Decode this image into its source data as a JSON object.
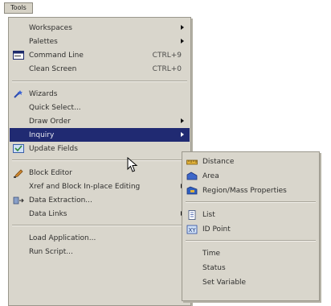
{
  "menubar": {
    "title": "Tools"
  },
  "tools_menu": {
    "items": [
      {
        "label": "Workspaces",
        "shortcut": "",
        "icon": "",
        "submenu": true
      },
      {
        "label": "Palettes",
        "shortcut": "",
        "icon": "",
        "submenu": true
      },
      {
        "label": "Command Line",
        "shortcut": "CTRL+9",
        "icon": "command-line-icon",
        "submenu": false
      },
      {
        "label": "Clean Screen",
        "shortcut": "CTRL+0",
        "icon": "",
        "submenu": false
      },
      {
        "label": "Wizards",
        "shortcut": "",
        "icon": "wizard-icon",
        "submenu": false
      },
      {
        "label": "Quick Select...",
        "shortcut": "",
        "icon": "",
        "submenu": false
      },
      {
        "label": "Draw Order",
        "shortcut": "",
        "icon": "",
        "submenu": true
      },
      {
        "label": "Inquiry",
        "shortcut": "",
        "icon": "",
        "submenu": true
      },
      {
        "label": "Update Fields",
        "shortcut": "",
        "icon": "update-fields-icon",
        "submenu": false
      },
      {
        "label": "Block Editor",
        "shortcut": "",
        "icon": "block-editor-icon",
        "submenu": false
      },
      {
        "label": "Xref and Block In-place Editing",
        "shortcut": "",
        "icon": "",
        "submenu": true
      },
      {
        "label": "Data Extraction...",
        "shortcut": "",
        "icon": "data-extraction-icon",
        "submenu": false
      },
      {
        "label": "Data Links",
        "shortcut": "",
        "icon": "",
        "submenu": true
      },
      {
        "label": "Load Application...",
        "shortcut": "",
        "icon": "",
        "submenu": false
      },
      {
        "label": "Run Script...",
        "shortcut": "",
        "icon": "",
        "submenu": false
      }
    ]
  },
  "inquiry_menu": {
    "items": [
      {
        "label": "Distance",
        "icon": "distance-icon"
      },
      {
        "label": "Area",
        "icon": "area-icon"
      },
      {
        "label": "Region/Mass Properties",
        "icon": "region-mass-icon"
      },
      {
        "label": "List",
        "icon": "list-icon"
      },
      {
        "label": "ID Point",
        "icon": "id-point-icon"
      },
      {
        "label": "Time",
        "icon": ""
      },
      {
        "label": "Status",
        "icon": ""
      },
      {
        "label": "Set Variable",
        "icon": ""
      }
    ]
  },
  "colors": {
    "highlight": "#202a72",
    "menu_bg": "#d9d6cc"
  }
}
